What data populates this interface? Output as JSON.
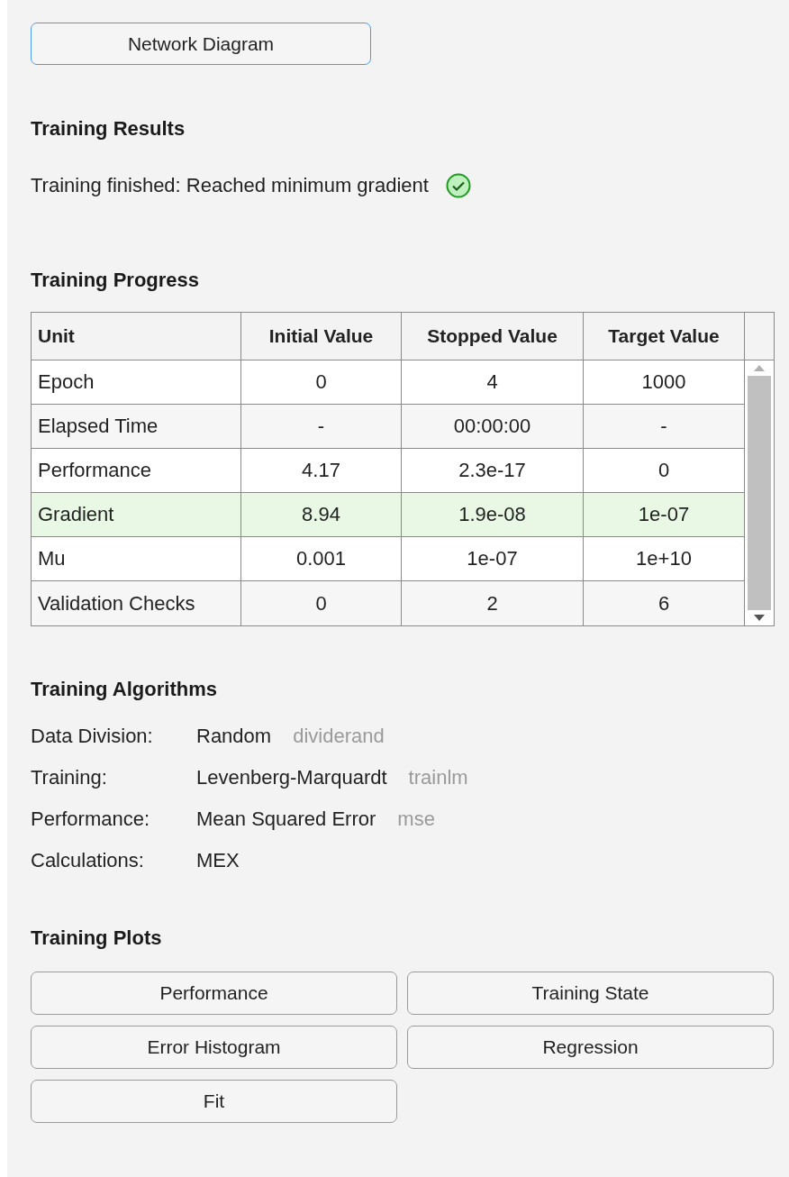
{
  "network_button": {
    "label": "Network Diagram",
    "focused": true
  },
  "training_results": {
    "heading": "Training Results",
    "message": "Training finished: Reached minimum gradient",
    "success": true
  },
  "training_progress": {
    "heading": "Training Progress",
    "columns": [
      "Unit",
      "Initial Value",
      "Stopped Value",
      "Target Value"
    ],
    "rows": [
      {
        "cells": [
          "Epoch",
          "0",
          "4",
          "1000"
        ],
        "highlighted": false
      },
      {
        "cells": [
          "Elapsed Time",
          "-",
          "00:00:00",
          "-"
        ],
        "highlighted": false
      },
      {
        "cells": [
          "Performance",
          "4.17",
          "2.3e-17",
          "0"
        ],
        "highlighted": false
      },
      {
        "cells": [
          "Gradient",
          "8.94",
          "1.9e-08",
          "1e-07"
        ],
        "highlighted": true
      },
      {
        "cells": [
          "Mu",
          "0.001",
          "1e-07",
          "1e+10"
        ],
        "highlighted": false
      },
      {
        "cells": [
          "Validation Checks",
          "0",
          "2",
          "6"
        ],
        "highlighted": false
      }
    ]
  },
  "training_algorithms": {
    "heading": "Training Algorithms",
    "rows": [
      {
        "label": "Data Division:",
        "value": "Random",
        "function": "dividerand"
      },
      {
        "label": "Training:",
        "value": "Levenberg-Marquardt",
        "function": "trainlm"
      },
      {
        "label": "Performance:",
        "value": "Mean Squared Error",
        "function": "mse"
      },
      {
        "label": "Calculations:",
        "value": "MEX"
      }
    ]
  },
  "training_plots": {
    "heading": "Training Plots",
    "buttons": [
      "Performance",
      "Training State",
      "Error Histogram",
      "Regression",
      "Fit"
    ]
  }
}
